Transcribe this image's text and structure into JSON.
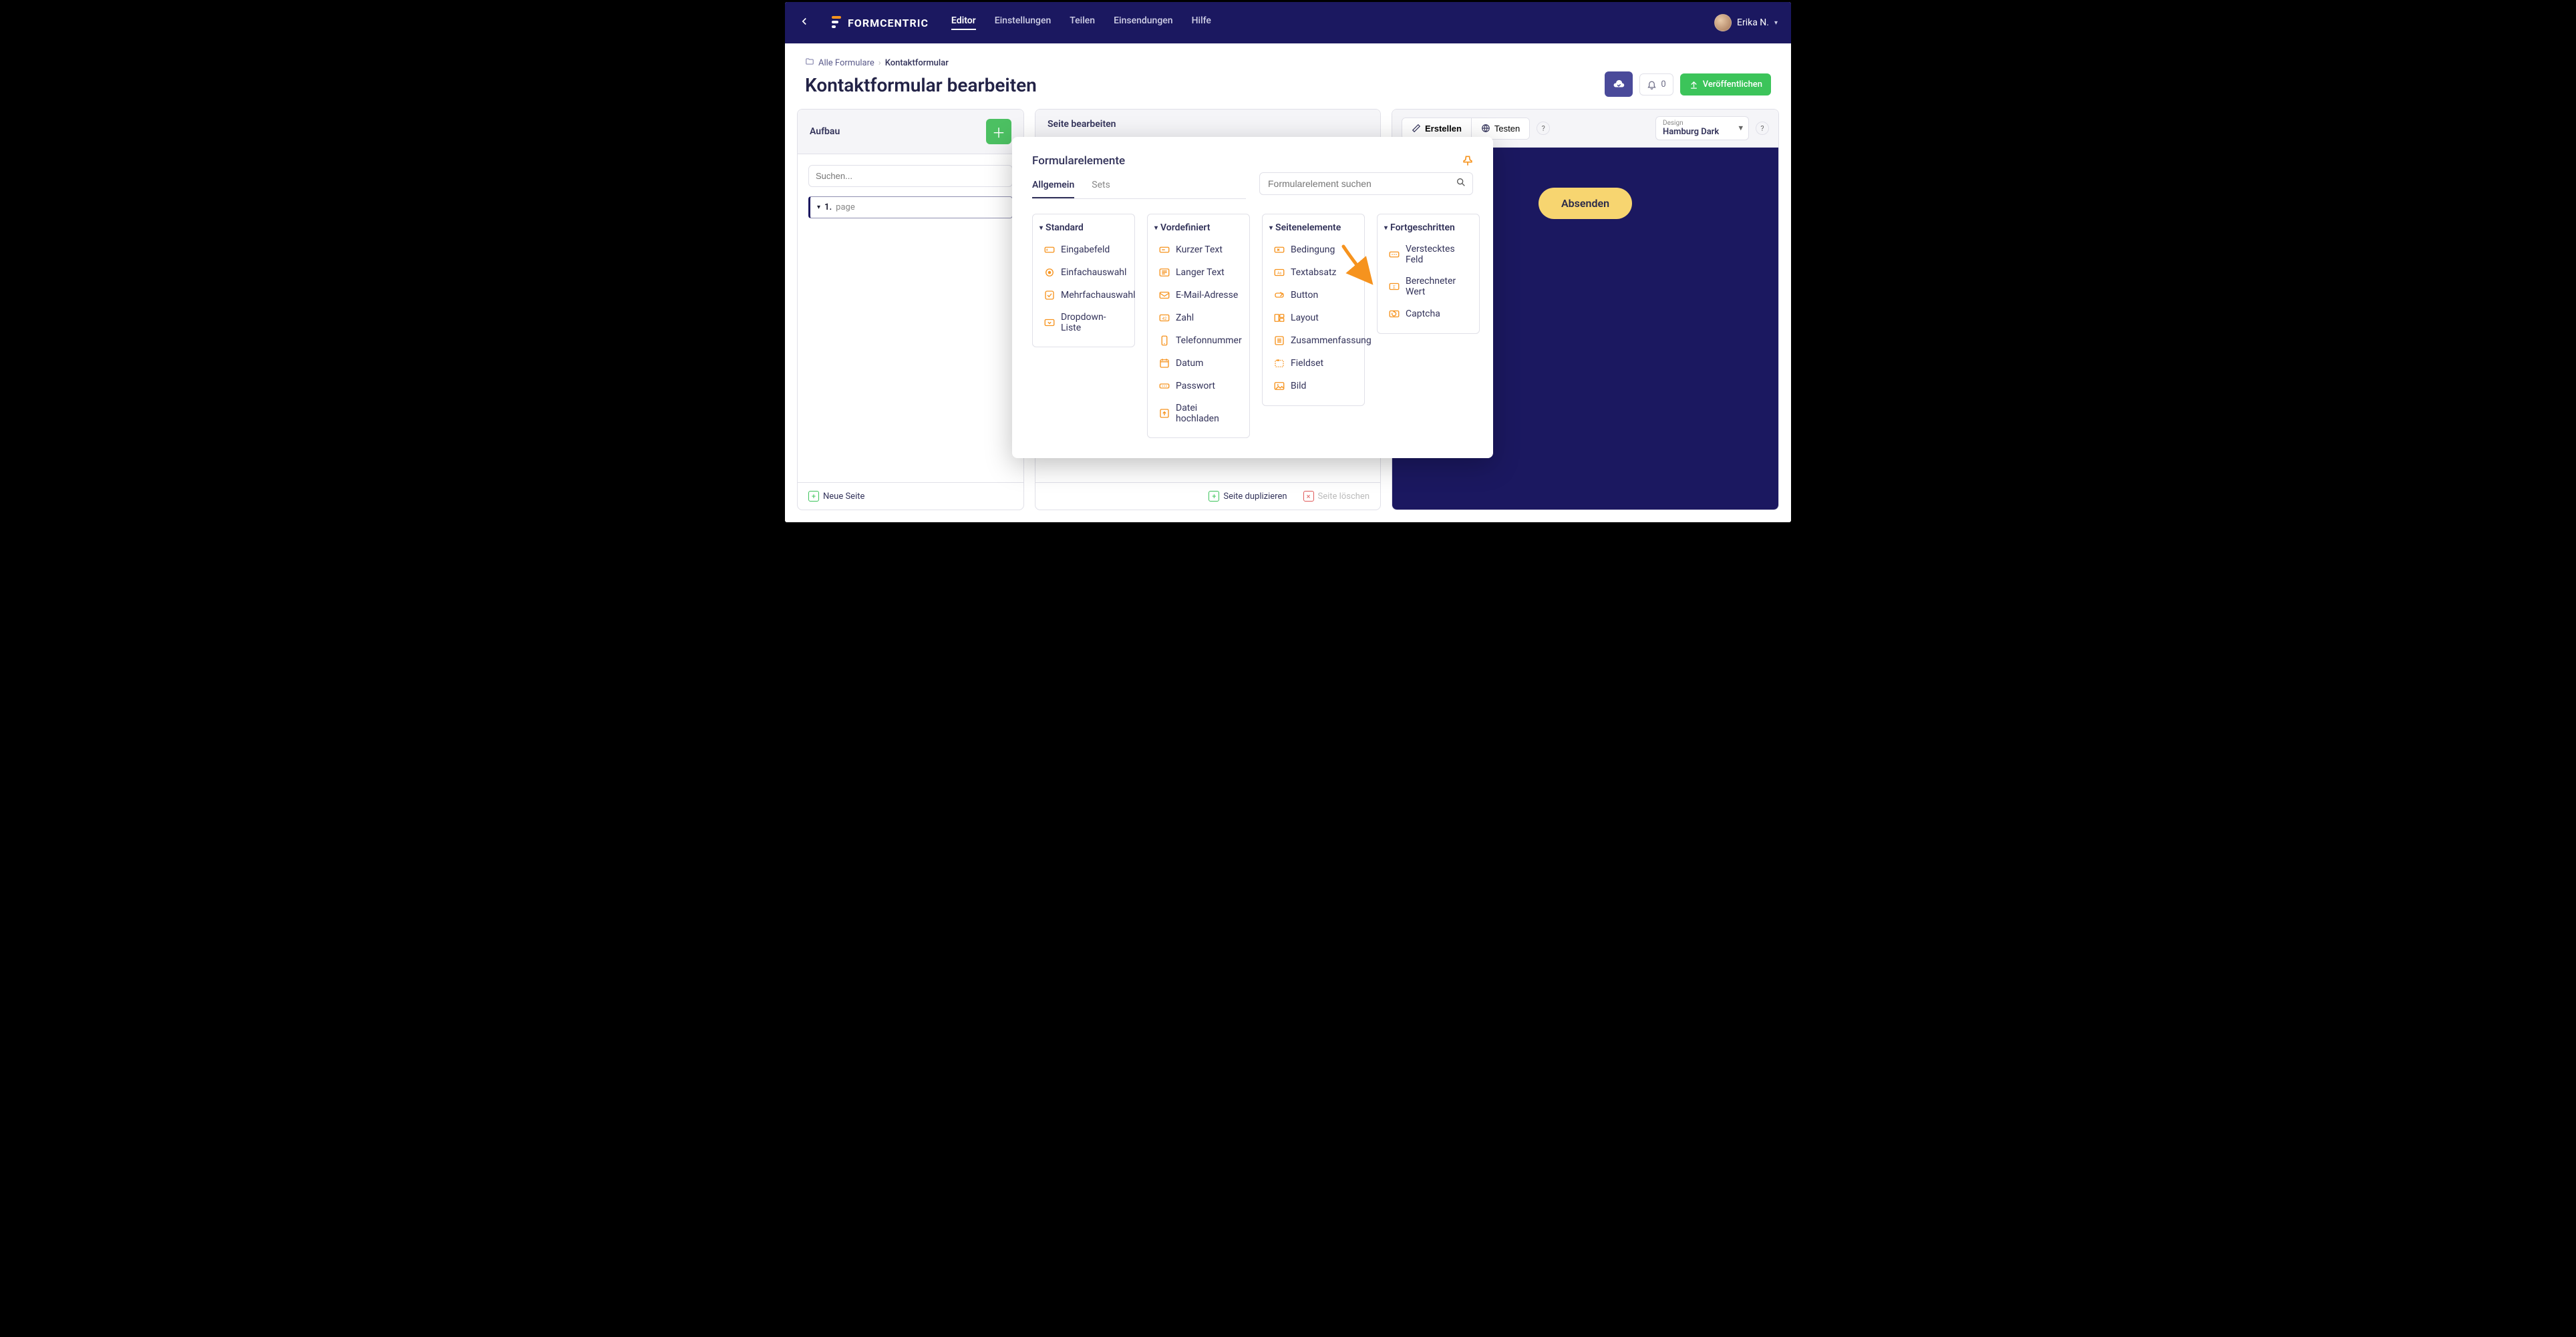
{
  "nav": {
    "brand": "FORMCENTRIC",
    "tabs": [
      "Editor",
      "Einstellungen",
      "Teilen",
      "Einsendungen",
      "Hilfe"
    ],
    "active_tab": 0,
    "user_name": "Erika N."
  },
  "breadcrumb": {
    "root": "Alle Formulare",
    "current": "Kontaktformular"
  },
  "page_title": "Kontaktformular bearbeiten",
  "header_actions": {
    "notifications_count": "0",
    "publish_label": "Veröffentlichen"
  },
  "left": {
    "title": "Aufbau",
    "search_placeholder": "Suchen...",
    "tree": {
      "index": "1.",
      "name": "page"
    },
    "footer_new_page": "Neue Seite"
  },
  "mid": {
    "title": "Seite bearbeiten",
    "footer_duplicate": "Seite duplizieren",
    "footer_delete": "Seite löschen"
  },
  "right": {
    "create_label": "Erstellen",
    "test_label": "Testen",
    "design_label": "Design",
    "design_value": "Hamburg Dark",
    "submit_label": "Absenden"
  },
  "popup": {
    "title": "Formularelemente",
    "tabs": [
      "Allgemein",
      "Sets"
    ],
    "active_tab": 0,
    "search_placeholder": "Formularelement suchen",
    "categories": [
      {
        "name": "Standard",
        "items": [
          "Eingabefeld",
          "Einfachauswahl",
          "Mehrfachauswahl",
          "Dropdown-Liste"
        ]
      },
      {
        "name": "Vordefiniert",
        "items": [
          "Kurzer Text",
          "Langer Text",
          "E-Mail-Adresse",
          "Zahl",
          "Telefonnummer",
          "Datum",
          "Passwort",
          "Datei hochladen"
        ]
      },
      {
        "name": "Seitenelemente",
        "items": [
          "Bedingung",
          "Textabsatz",
          "Button",
          "Layout",
          "Zusammenfassung",
          "Fieldset",
          "Bild"
        ]
      },
      {
        "name": "Fortgeschritten",
        "items": [
          "Verstecktes Feld",
          "Berechneter Wert",
          "Captcha"
        ]
      }
    ]
  }
}
